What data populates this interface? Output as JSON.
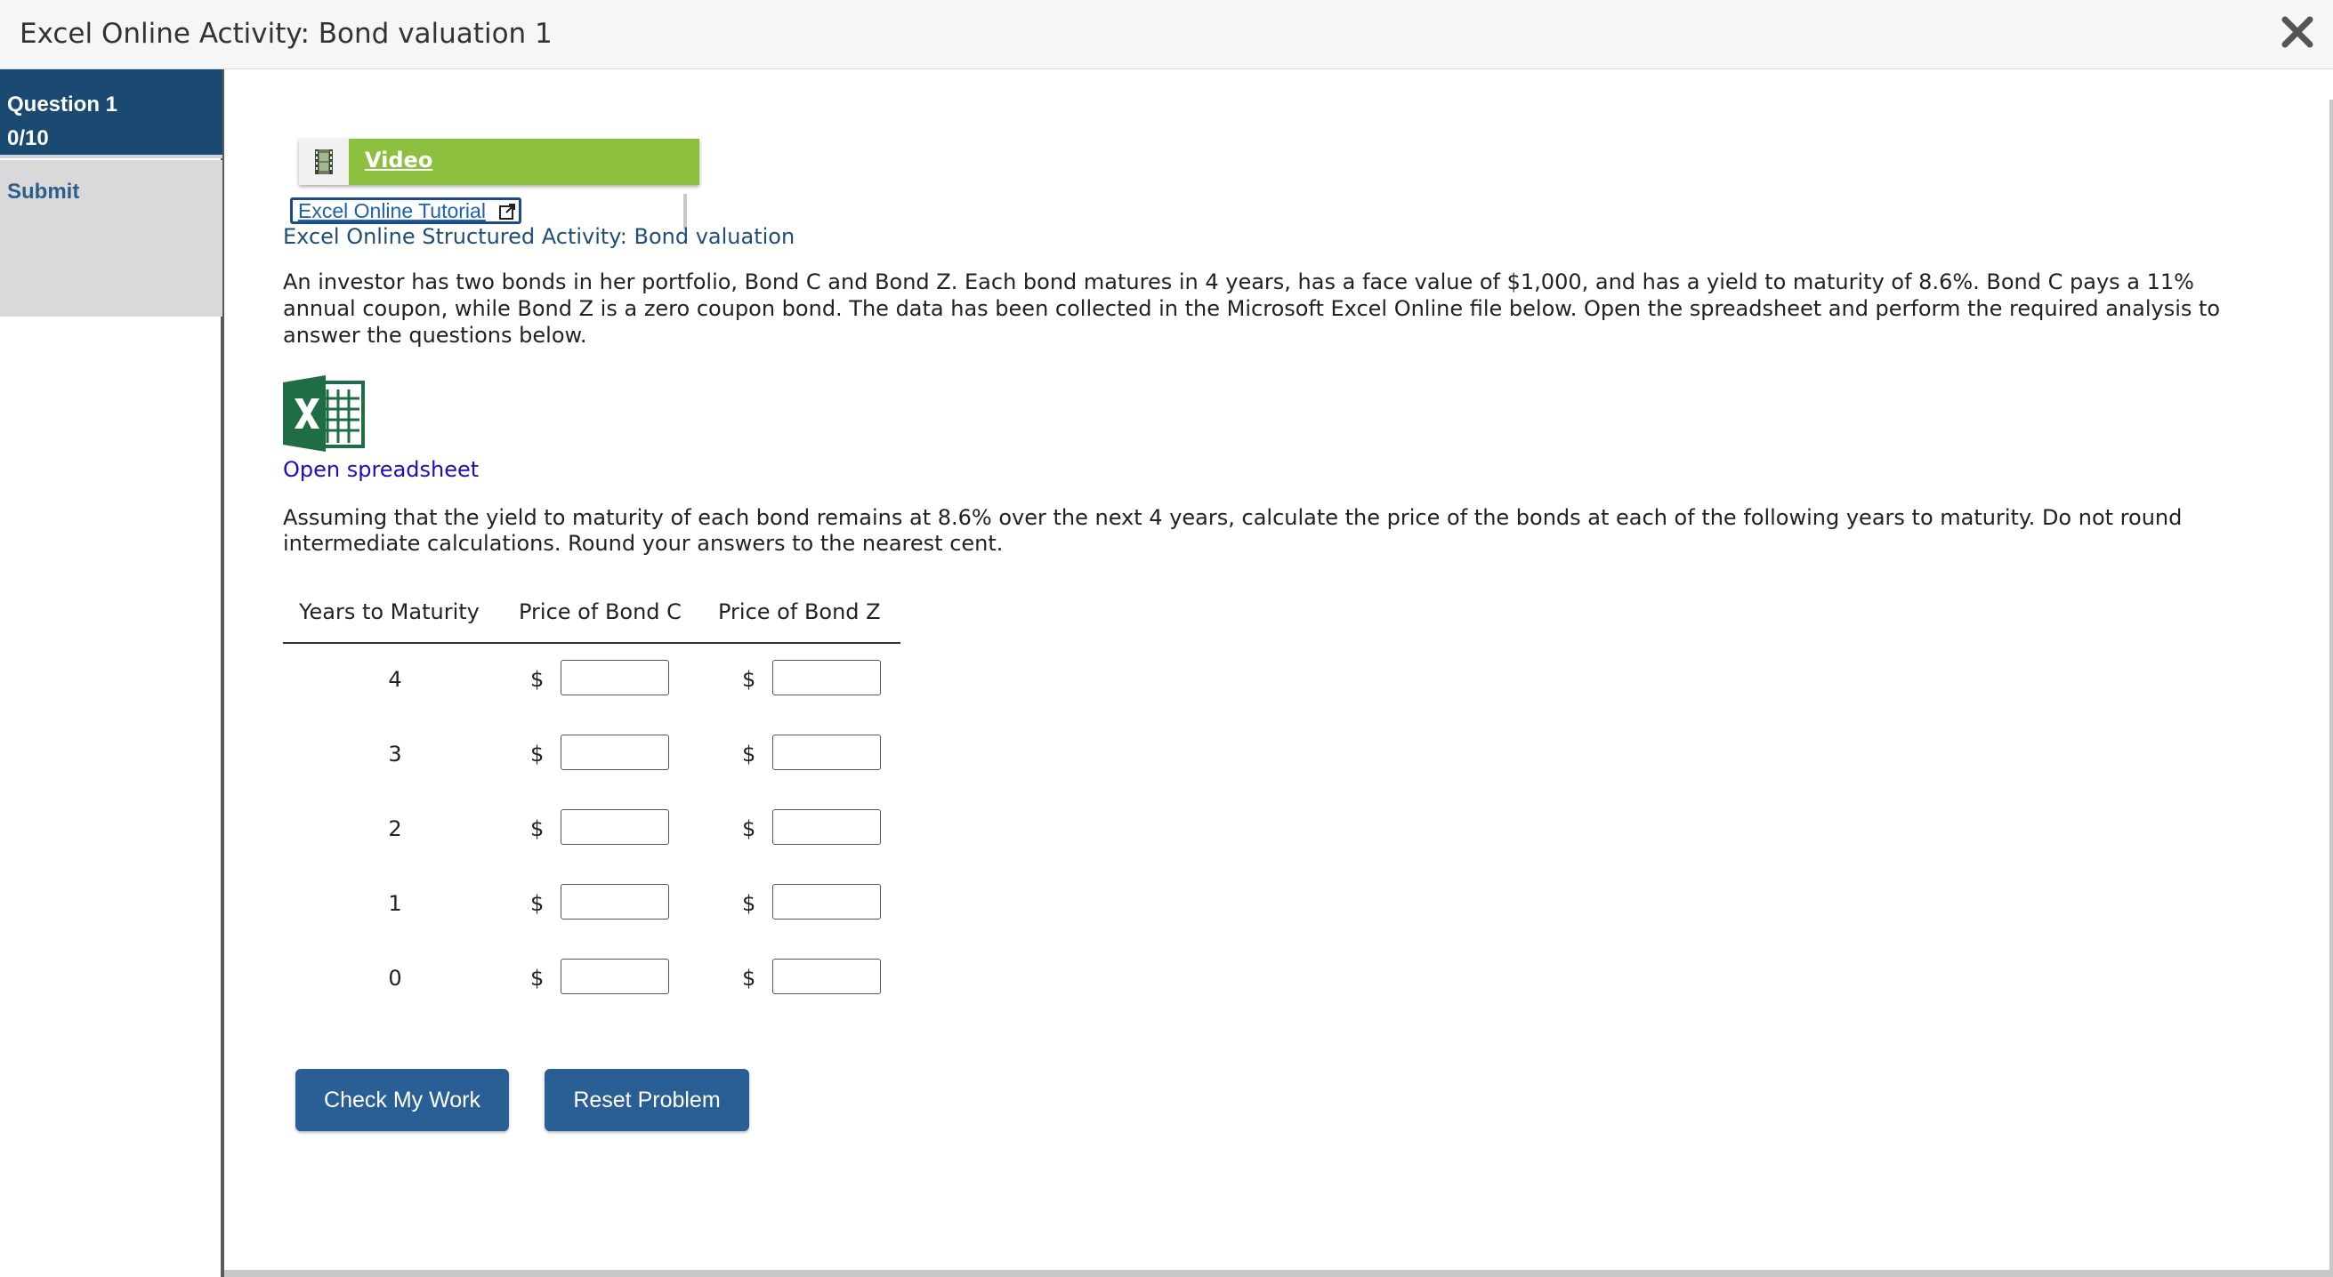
{
  "window": {
    "title": "Excel Online Activity: Bond valuation 1",
    "close_icon": "close-icon"
  },
  "sidebar": {
    "question_label": "Question 1",
    "score": "0/10",
    "submit_label": "Submit"
  },
  "main": {
    "video_label": "Video",
    "video_icon": "film-icon",
    "tutorial_label": "Excel Online Tutorial",
    "subtitle": "Excel Online Structured Activity: Bond valuation",
    "intro": "An investor has two bonds in her portfolio, Bond C and Bond Z. Each bond matures in 4 years, has a face value of $1,000, and has a yield to maturity of 8.6%. Bond C pays a 11% annual coupon, while Bond Z is a zero coupon bond. The data has been collected in the Microsoft Excel Online file below. Open the spreadsheet and perform the required analysis to answer the questions below.",
    "spreadsheet_icon": "excel-icon",
    "open_spreadsheet_label": "Open spreadsheet",
    "instructions": "Assuming that the yield to maturity of each bond remains at 8.6% over the next 4 years, calculate the price of the bonds at each of the following years to maturity. Do not round intermediate calculations. Round your answers to the nearest cent."
  },
  "table": {
    "headers": [
      "Years to Maturity",
      "Price of Bond C",
      "Price of Bond Z"
    ],
    "currency": "$",
    "rows": [
      {
        "years": "4",
        "bond_c": "",
        "bond_z": ""
      },
      {
        "years": "3",
        "bond_c": "",
        "bond_z": ""
      },
      {
        "years": "2",
        "bond_c": "",
        "bond_z": ""
      },
      {
        "years": "1",
        "bond_c": "",
        "bond_z": ""
      },
      {
        "years": "0",
        "bond_c": "",
        "bond_z": ""
      }
    ]
  },
  "buttons": {
    "check_label": "Check My Work",
    "reset_label": "Reset Problem"
  },
  "colors": {
    "sidebar_active": "#1a4a72",
    "video_green": "#8dc03f",
    "button_blue": "#2a5f96",
    "excel_green": "#1f6e43"
  }
}
